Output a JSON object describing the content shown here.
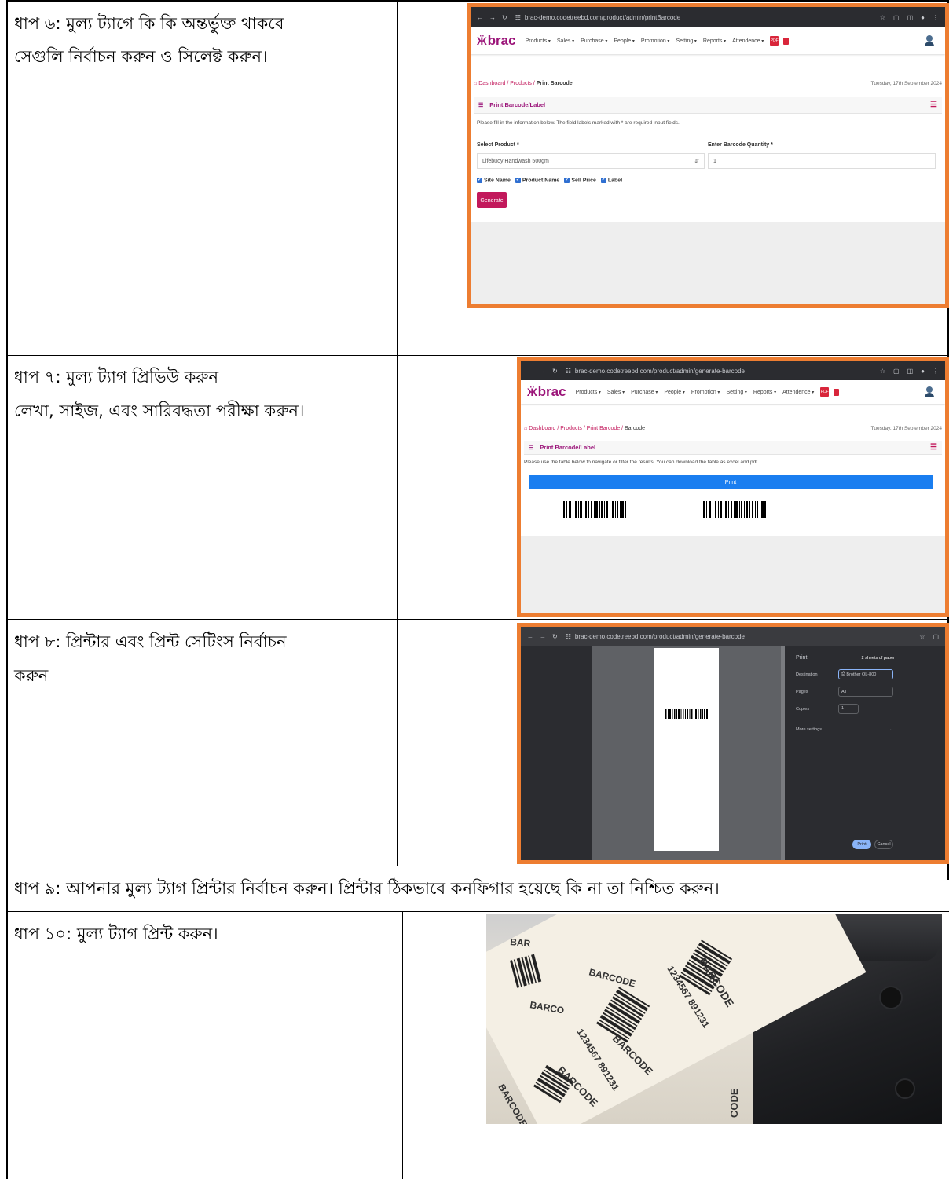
{
  "steps": {
    "s6": {
      "line1": "ধাপ ৬: মুল্য ট্যাগে কি কি অন্তর্ভুক্ত থাকবে",
      "line2": "সেগুলি নির্বাচন করুন ও সিলেক্ট করুন।"
    },
    "s7": {
      "line1": "ধাপ ৭: মুল্য ট্যাগ প্রিভিউ করুন",
      "line2": "লেখা, সাইজ, এবং সারিবদ্ধতা পরীক্ষা করুন।"
    },
    "s8": {
      "line1": "ধাপ ৮: প্রিন্টার এবং প্রিন্ট সেটিংস নির্বাচন",
      "line2": "করুন"
    },
    "s9": {
      "line1": "ধাপ ৯: আপনার মুল্য ট্যাগ প্রিন্টার নির্বাচন করুন। প্রিন্টার ঠিকভাবে কনফিগার হয়েছে কি না তা নিশ্চিত করুন।"
    },
    "s10": {
      "line1": "ধাপ ১০: মুল্য ট্যাগ প্রিন্ট করুন।"
    }
  },
  "app": {
    "logo_text": "brac",
    "menu": [
      "Products",
      "Sales",
      "Purchase",
      "People",
      "Promotion",
      "Setting",
      "Reports",
      "Attendence"
    ],
    "pdf_icon_label": "PDF",
    "date": "Tuesday, 17th September 2024",
    "panel_title": "Print Barcode/Label"
  },
  "shot1": {
    "url": "brac-demo.codetreebd.com/product/admin/printBarcode",
    "crumb_links": "Dashboard / Products / ",
    "crumb_current": "Print Barcode",
    "note": "Please fill in the information below. The field labels marked with * are required input fields.",
    "select_label": "Select Product *",
    "select_value": "Lifebuoy Handwash 500gm",
    "qty_label": "Enter Barcode Quantity *",
    "qty_value": "1",
    "checks": [
      "Site Name",
      "Product Name",
      "Sell Price",
      "Label"
    ],
    "generate": "Generate"
  },
  "shot2": {
    "url": "brac-demo.codetreebd.com/product/admin/generate-barcode",
    "crumb_links": "Dashboard / Products / Print Barcode / ",
    "crumb_current": "Barcode",
    "note": "Please use the table below to navigate or filter the results. You can download the table as excel and pdf.",
    "print_label": "Print"
  },
  "shot3": {
    "url": "brac-demo.codetreebd.com/product/admin/generate-barcode",
    "print_title": "Print",
    "sheets": "2 sheets of paper",
    "rows": [
      {
        "label": "Destination",
        "value": "Brother QL-800"
      },
      {
        "label": "Pages",
        "value": "All"
      },
      {
        "label": "Copies",
        "value": "1"
      }
    ],
    "more_settings": "More settings",
    "print_btn": "Print",
    "cancel_btn": "Cancel"
  },
  "photo": {
    "labels": [
      "BARCODE",
      "1234567 891231",
      "BARCODE",
      "1234567 891231",
      "BARCODE",
      "BARCODE",
      "CODE",
      "BARCODE",
      "BARCO",
      "BAR"
    ]
  }
}
